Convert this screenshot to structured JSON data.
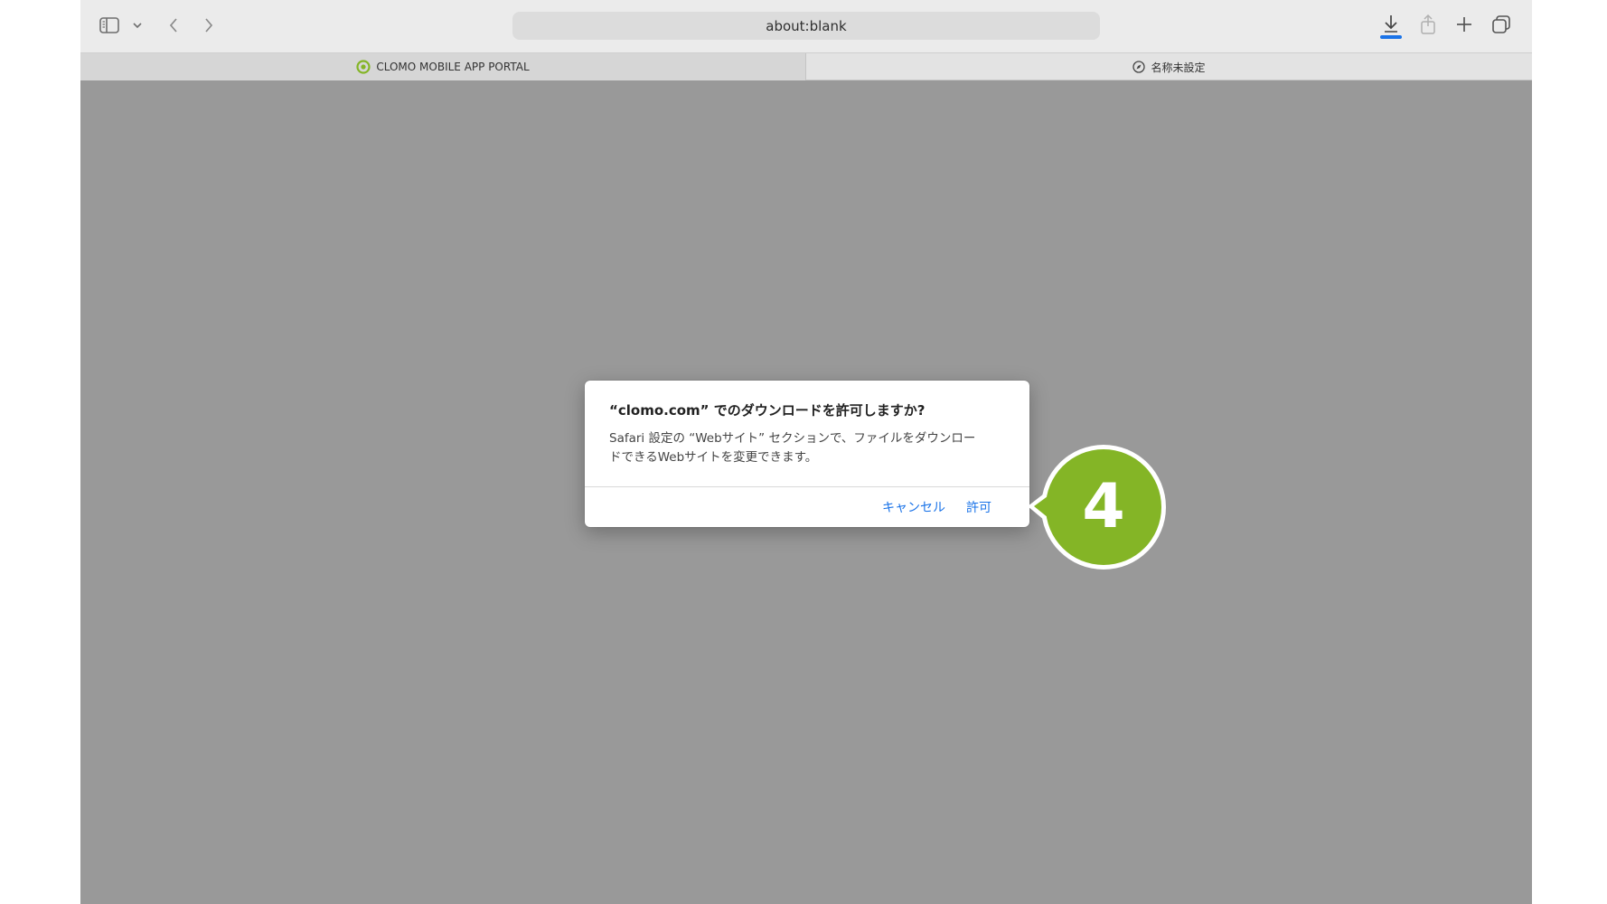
{
  "browser": {
    "address_bar": "about:blank",
    "tabs": [
      {
        "label": "CLOMO MOBILE APP PORTAL",
        "icon": "clomo-logo-icon",
        "active": true
      },
      {
        "label": "名称未設定",
        "icon": "compass-icon",
        "active": false
      }
    ],
    "toolbar_icons": [
      "sidebar-icon",
      "chevron-down-icon",
      "back-icon",
      "forward-icon",
      "download-icon",
      "share-icon",
      "plus-icon",
      "tabs-overview-icon"
    ]
  },
  "dialog": {
    "title": "“clomo.com” でのダウンロードを許可しますか?",
    "message_line1": "Safari 設定の “Webサイト” セクションで、ファイルをダウンロー",
    "message_line2": "ドできるWebサイトを変更できます。",
    "cancel_label": "キャンセル",
    "allow_label": "許可"
  },
  "callout": {
    "number": "4",
    "color": "#84b526"
  },
  "colors": {
    "accent": "#1a73e8",
    "download_indicator": "#1a73e8",
    "content_background": "#999999"
  }
}
